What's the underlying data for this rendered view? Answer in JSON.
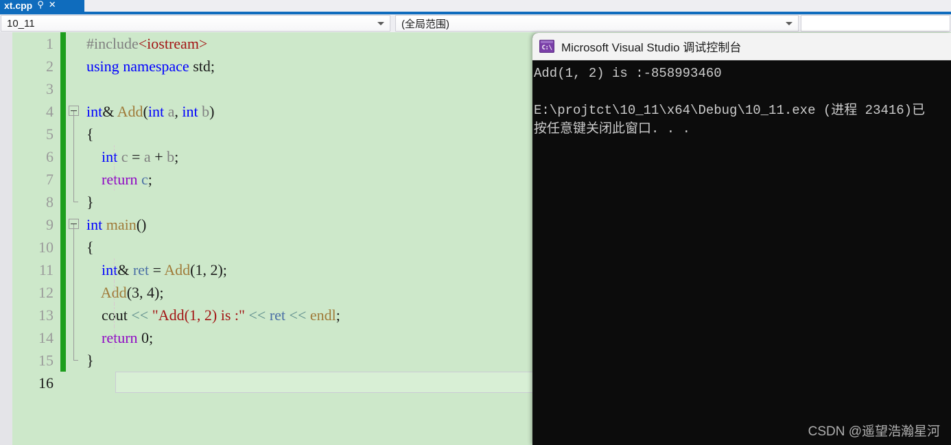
{
  "tab": {
    "title": "xt.cpp",
    "pin_icon": "pin-icon",
    "close_icon": "close-icon"
  },
  "navbar": {
    "project_scope": "10_11",
    "member_scope": "(全局范围)",
    "third_value": ""
  },
  "editor": {
    "lines": [
      {
        "num": "1",
        "tokens": [
          {
            "t": "#include",
            "c": "t-pre"
          },
          {
            "t": "<iostream>",
            "c": "t-str"
          }
        ]
      },
      {
        "num": "2",
        "tokens": [
          {
            "t": "using",
            "c": "t-kw"
          },
          {
            "t": " ",
            "c": "t-plain"
          },
          {
            "t": "namespace",
            "c": "t-kw"
          },
          {
            "t": " std;",
            "c": "t-plain"
          }
        ]
      },
      {
        "num": "3",
        "tokens": []
      },
      {
        "num": "4",
        "tokens": [
          {
            "t": "int",
            "c": "t-kw"
          },
          {
            "t": "& ",
            "c": "t-plain"
          },
          {
            "t": "Add",
            "c": "t-fn"
          },
          {
            "t": "(",
            "c": "t-plain"
          },
          {
            "t": "int",
            "c": "t-kw"
          },
          {
            "t": " ",
            "c": "t-plain"
          },
          {
            "t": "a",
            "c": "t-var"
          },
          {
            "t": ", ",
            "c": "t-plain"
          },
          {
            "t": "int",
            "c": "t-kw"
          },
          {
            "t": " ",
            "c": "t-plain"
          },
          {
            "t": "b",
            "c": "t-var"
          },
          {
            "t": ")",
            "c": "t-plain"
          }
        ]
      },
      {
        "num": "5",
        "tokens": [
          {
            "t": "{",
            "c": "t-plain"
          }
        ]
      },
      {
        "num": "6",
        "tokens": [
          {
            "t": "    ",
            "c": "t-plain"
          },
          {
            "t": "int",
            "c": "t-kw"
          },
          {
            "t": " ",
            "c": "t-plain"
          },
          {
            "t": "c",
            "c": "t-var"
          },
          {
            "t": " = ",
            "c": "t-plain"
          },
          {
            "t": "a",
            "c": "t-var"
          },
          {
            "t": " + ",
            "c": "t-plain"
          },
          {
            "t": "b",
            "c": "t-var"
          },
          {
            "t": ";",
            "c": "t-plain"
          }
        ]
      },
      {
        "num": "7",
        "tokens": [
          {
            "t": "    ",
            "c": "t-plain"
          },
          {
            "t": "return",
            "c": "t-kw2"
          },
          {
            "t": " ",
            "c": "t-plain"
          },
          {
            "t": "c",
            "c": "t-loc"
          },
          {
            "t": ";",
            "c": "t-plain"
          }
        ]
      },
      {
        "num": "8",
        "tokens": [
          {
            "t": "}",
            "c": "t-plain"
          }
        ]
      },
      {
        "num": "9",
        "tokens": [
          {
            "t": "int",
            "c": "t-kw"
          },
          {
            "t": " ",
            "c": "t-plain"
          },
          {
            "t": "main",
            "c": "t-fn"
          },
          {
            "t": "()",
            "c": "t-plain"
          }
        ]
      },
      {
        "num": "10",
        "tokens": [
          {
            "t": "{",
            "c": "t-plain"
          }
        ]
      },
      {
        "num": "11",
        "tokens": [
          {
            "t": "    ",
            "c": "t-plain"
          },
          {
            "t": "int",
            "c": "t-kw"
          },
          {
            "t": "& ",
            "c": "t-plain"
          },
          {
            "t": "ret",
            "c": "t-loc"
          },
          {
            "t": " = ",
            "c": "t-plain"
          },
          {
            "t": "Add",
            "c": "t-fn"
          },
          {
            "t": "(",
            "c": "t-plain"
          },
          {
            "t": "1",
            "c": "t-num"
          },
          {
            "t": ", ",
            "c": "t-plain"
          },
          {
            "t": "2",
            "c": "t-num"
          },
          {
            "t": ");",
            "c": "t-plain"
          }
        ]
      },
      {
        "num": "12",
        "tokens": [
          {
            "t": "    ",
            "c": "t-plain"
          },
          {
            "t": "Add",
            "c": "t-fn"
          },
          {
            "t": "(",
            "c": "t-plain"
          },
          {
            "t": "3",
            "c": "t-num"
          },
          {
            "t": ", ",
            "c": "t-plain"
          },
          {
            "t": "4",
            "c": "t-num"
          },
          {
            "t": ");",
            "c": "t-plain"
          }
        ]
      },
      {
        "num": "13",
        "tokens": [
          {
            "t": "    ",
            "c": "t-plain"
          },
          {
            "t": "cout",
            "c": "t-plain"
          },
          {
            "t": " ",
            "c": "t-plain"
          },
          {
            "t": "<<",
            "c": "t-op"
          },
          {
            "t": " ",
            "c": "t-plain"
          },
          {
            "t": "\"Add(1, 2) is :\"",
            "c": "t-str"
          },
          {
            "t": " ",
            "c": "t-plain"
          },
          {
            "t": "<<",
            "c": "t-op"
          },
          {
            "t": " ",
            "c": "t-plain"
          },
          {
            "t": "ret",
            "c": "t-loc"
          },
          {
            "t": " ",
            "c": "t-plain"
          },
          {
            "t": "<<",
            "c": "t-op"
          },
          {
            "t": " ",
            "c": "t-plain"
          },
          {
            "t": "endl",
            "c": "t-fn"
          },
          {
            "t": ";",
            "c": "t-plain"
          }
        ]
      },
      {
        "num": "14",
        "tokens": [
          {
            "t": "    ",
            "c": "t-plain"
          },
          {
            "t": "return",
            "c": "t-kw2"
          },
          {
            "t": " ",
            "c": "t-plain"
          },
          {
            "t": "0",
            "c": "t-num"
          },
          {
            "t": ";",
            "c": "t-plain"
          }
        ]
      },
      {
        "num": "15",
        "tokens": [
          {
            "t": "}",
            "c": "t-plain"
          }
        ]
      },
      {
        "num": "16",
        "tokens": [],
        "current": true
      }
    ]
  },
  "console": {
    "icon": "console-icon",
    "icon_text": "C:\\",
    "title": "Microsoft Visual Studio 调试控制台",
    "output": [
      "Add(1, 2) is :-858993460",
      "",
      "E:\\projtct\\10_11\\x64\\Debug\\10_11.exe (进程 23416)已",
      "按任意键关闭此窗口. . ."
    ],
    "watermark": "CSDN @遥望浩瀚星河"
  },
  "colors": {
    "accent": "#0f6cbd",
    "editor_bg": "#cde8ca",
    "change_bar": "#1d9e1d",
    "console_bg": "#0c0c0c",
    "string": "#a31515",
    "keyword": "#0000ff",
    "keyword_flow": "#8f08c4"
  }
}
